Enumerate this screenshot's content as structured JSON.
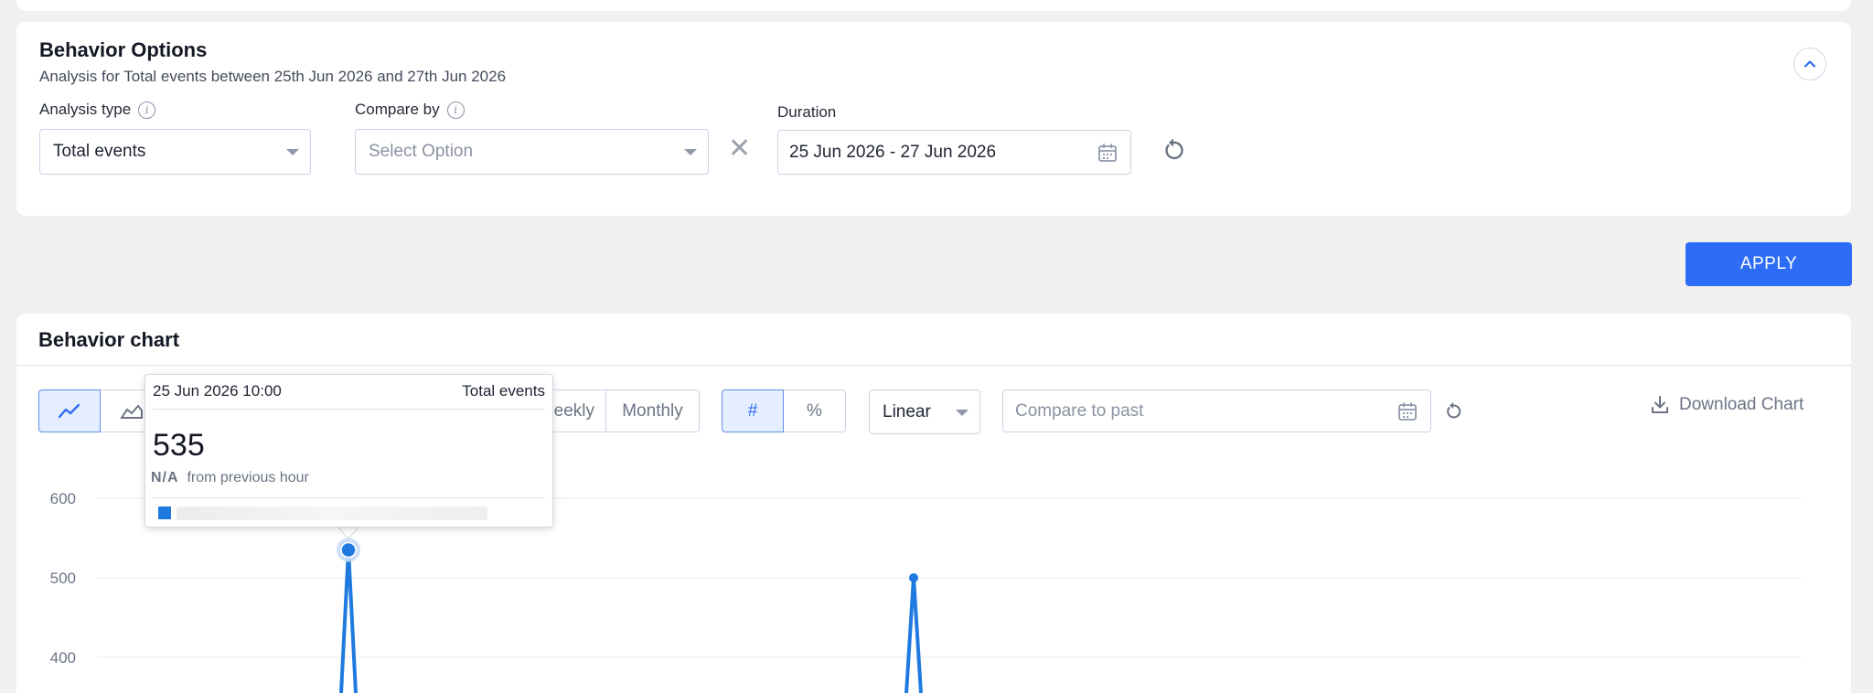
{
  "options": {
    "title": "Behavior Options",
    "subtitle": "Analysis for Total events between 25th Jun 2026 and 27th Jun 2026",
    "analysis_type_label": "Analysis type",
    "analysis_type_value": "Total events",
    "compare_by_label": "Compare by",
    "compare_by_placeholder": "Select Option",
    "duration_label": "Duration",
    "duration_value": "25 Jun 2026 - 27 Jun 2026"
  },
  "apply_label": "APPLY",
  "chart_section": {
    "title": "Behavior chart",
    "interval_visible": [
      "eekly",
      "Monthly"
    ],
    "value_mode": [
      "#",
      "%"
    ],
    "scale_value": "Linear",
    "compare_past_placeholder": "Compare to past",
    "download_label": "Download Chart"
  },
  "tooltip": {
    "time": "25 Jun 2026 10:00",
    "series": "Total events",
    "value": "535",
    "change_value": "N/A",
    "change_text": "from previous hour"
  },
  "colors": {
    "accent": "#2d6cf5",
    "series": "#1f7ae0"
  },
  "chart_data": {
    "type": "line",
    "ylim": [
      350,
      620
    ],
    "yticks": [
      {
        "value": 600,
        "label": "600"
      },
      {
        "value": 500,
        "label": "500"
      },
      {
        "value": 400,
        "label": "400"
      }
    ],
    "series": [
      {
        "points": [
          {
            "x": "25 Jun 2026 10:00",
            "y": 535
          },
          {
            "x": "26 Jun 2026",
            "y": 500
          }
        ]
      }
    ]
  }
}
